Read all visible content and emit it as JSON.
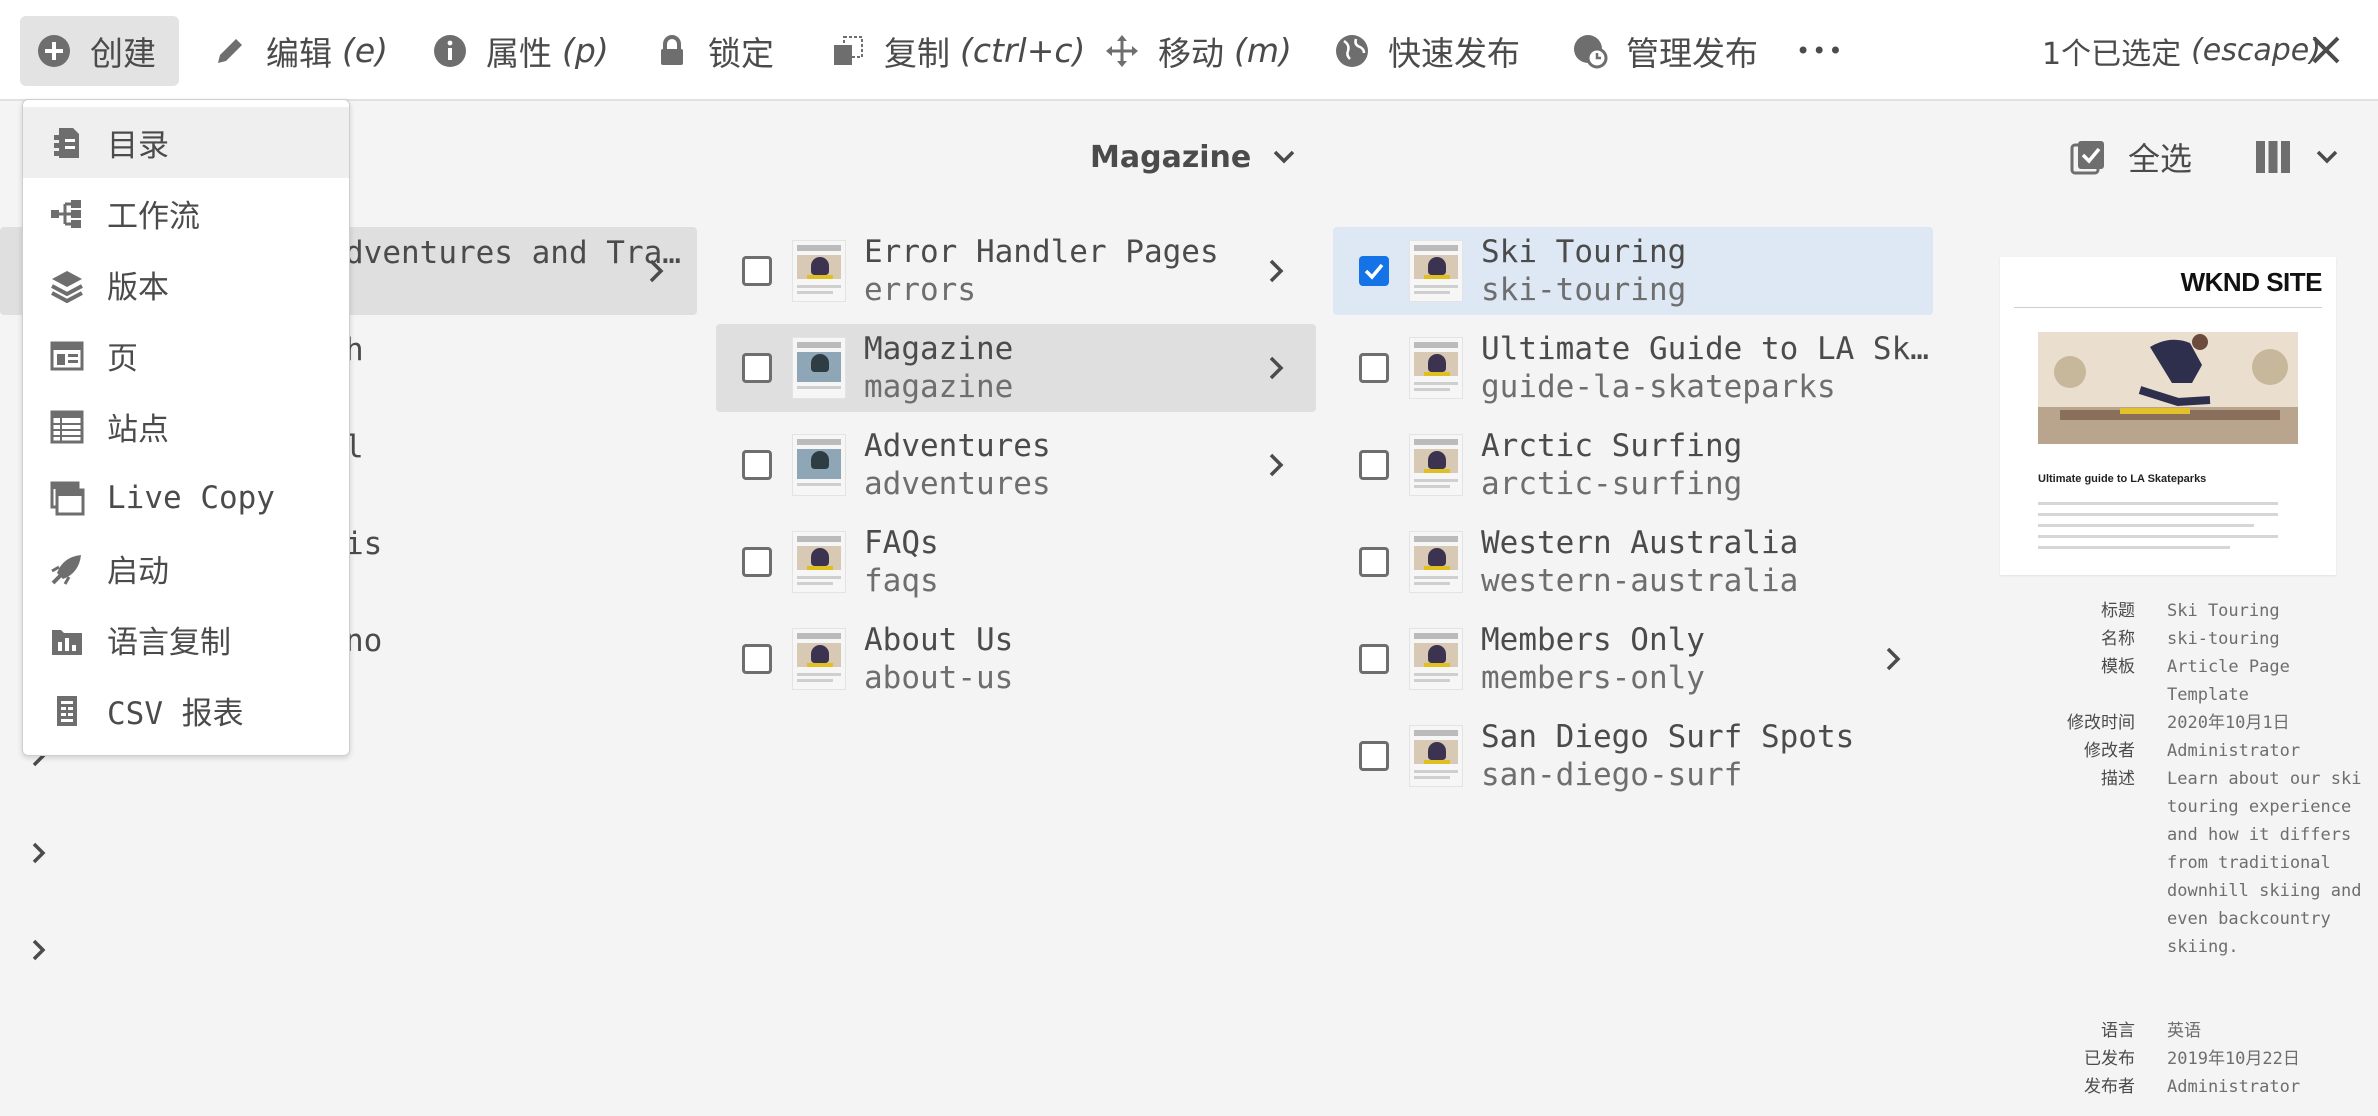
{
  "action_bar": {
    "create": "创建",
    "edit": "编辑",
    "edit_sc": "(e)",
    "properties": "属性",
    "properties_sc": "(p)",
    "lock": "锁定",
    "copy": "复制",
    "copy_sc": "(ctrl+c)",
    "move": "移动",
    "move_sc": "(m)",
    "quick_publish": "快速发布",
    "manage_publication": "管理发布",
    "more": "•••",
    "selection_count": "1个已选定",
    "selection_sc": "(escape)"
  },
  "header": {
    "title": "Magazine",
    "select_all": "全选"
  },
  "create_menu": [
    {
      "label": "目录",
      "icon": "catalog-icon"
    },
    {
      "label": "工作流",
      "icon": "workflow-icon"
    },
    {
      "label": "版本",
      "icon": "layers-icon"
    },
    {
      "label": "页",
      "icon": "page-icon"
    },
    {
      "label": "站点",
      "icon": "site-icon"
    },
    {
      "label": "Live Copy",
      "icon": "live-copy-icon"
    },
    {
      "label": "启动",
      "icon": "launch-icon"
    },
    {
      "label": "语言复制",
      "icon": "language-copy-icon"
    },
    {
      "label": "CSV 报表",
      "icon": "csv-report-icon"
    }
  ],
  "column1": [
    {
      "peek": "dventures and Tra…"
    },
    {
      "peek": "h"
    },
    {
      "peek": "l"
    },
    {
      "peek": "is"
    },
    {
      "peek": "no"
    }
  ],
  "column2": [
    {
      "title": "Error Handler Pages",
      "name": "errors"
    },
    {
      "title": "Magazine",
      "name": "magazine"
    },
    {
      "title": "Adventures",
      "name": "adventures"
    },
    {
      "title": "FAQs",
      "name": "faqs"
    },
    {
      "title": "About Us",
      "name": "about-us"
    }
  ],
  "column3": [
    {
      "title": "Ski Touring",
      "name": "ski-touring"
    },
    {
      "title": "Ultimate Guide to LA Ska…",
      "name": "guide-la-skateparks"
    },
    {
      "title": "Arctic Surfing",
      "name": "arctic-surfing"
    },
    {
      "title": "Western Australia",
      "name": "western-australia"
    },
    {
      "title": "Members Only",
      "name": "members-only"
    },
    {
      "title": "San Diego Surf Spots",
      "name": "san-diego-surf"
    }
  ],
  "preview": {
    "brand": "WKND SITE",
    "heading": "Ultimate guide to LA Skateparks",
    "meta": [
      {
        "key": "标题",
        "value": "Ski Touring"
      },
      {
        "key": "名称",
        "value": "ski-touring"
      },
      {
        "key": "模板",
        "value": "Article Page Template"
      },
      {
        "key": "修改时间",
        "value": "2020年10月1日"
      },
      {
        "key": "修改者",
        "value": "Administrator"
      },
      {
        "key": "描述",
        "value": "Learn about our ski touring experience and how it differs from traditional downhill skiing and even backcountry skiing."
      },
      {
        "key": "语言",
        "value": "英语"
      },
      {
        "key": "已发布",
        "value": "2019年10月22日"
      },
      {
        "key": "发布者",
        "value": "Administrator"
      }
    ]
  },
  "colors": {
    "accent": "#1473e6",
    "active_row": "#dfdfdf",
    "selected_row": "#dde8f4"
  }
}
